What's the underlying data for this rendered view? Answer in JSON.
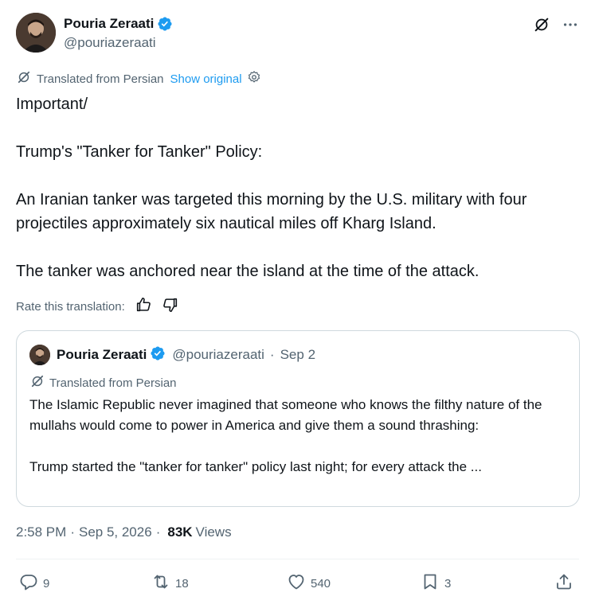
{
  "author": {
    "name": "Pouria Zeraati",
    "handle": "@pouriazeraati",
    "verified_color": "#1d9bf0"
  },
  "top_actions": {
    "grok_icon": "grok-icon",
    "more_icon": "more-icon"
  },
  "translation": {
    "label": "Translated from Persian",
    "show_original": "Show original",
    "settings_icon": "settings-icon"
  },
  "tweet": {
    "paragraphs": [
      "Important/",
      "Trump's \"Tanker for Tanker\" Policy:",
      "An Iranian tanker was targeted this morning by the U.S. military with four projectiles approximately six nautical miles off Kharg Island.",
      "The tanker was anchored near the island at the time of the attack."
    ]
  },
  "rate": {
    "label": "Rate this translation:",
    "up_icon": "thumbs-up-icon",
    "down_icon": "thumbs-down-icon"
  },
  "quote": {
    "name": "Pouria Zeraati",
    "handle": "@pouriazeraati",
    "separator": "·",
    "date": "Sep 2",
    "translated_label": "Translated from Persian",
    "paragraphs": [
      "The Islamic Republic never imagined that someone who knows the filthy nature of the mullahs would come to power in America and give them a sound thrashing:",
      "Trump started the \"tanker for tanker\" policy last night; for every attack the ..."
    ]
  },
  "meta": {
    "time": "2:58 PM",
    "separator": "·",
    "date": "Sep 5, 2026",
    "views_count": "83K",
    "views_label": "Views"
  },
  "actions": {
    "reply_count": "9",
    "repost_count": "18",
    "like_count": "540",
    "bookmark_count": "3"
  },
  "colors": {
    "text": "#0f1419",
    "secondary": "#536471",
    "link": "#1d9bf0",
    "border": "#cfd9de"
  }
}
